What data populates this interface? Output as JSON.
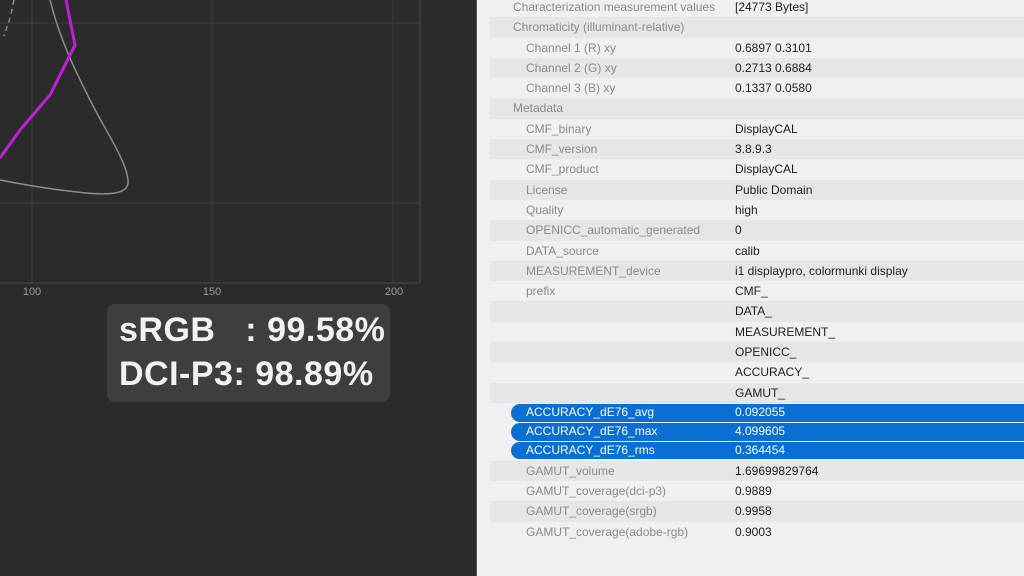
{
  "plot": {
    "x_ticks": [
      "100",
      "150",
      "200"
    ],
    "gamut_color": "#c21ed9",
    "grid_color": "#3d3d3d",
    "locus_color": "#8c8c8c"
  },
  "coverage": {
    "srgb": "sRGB   : 99.58%",
    "dcip3": "DCI-P3: 98.89%"
  },
  "table": {
    "rows": [
      {
        "key": "Characterization measurement values",
        "value": "[24773 Bytes]",
        "level": 0
      },
      {
        "key": "Chromaticity (illuminant-relative)",
        "value": "",
        "level": 0
      },
      {
        "key": "Channel 1 (R) xy",
        "value": "0.6897 0.3101",
        "level": 1
      },
      {
        "key": "Channel 2 (G) xy",
        "value": "0.2713 0.6884",
        "level": 1
      },
      {
        "key": "Channel 3 (B) xy",
        "value": "0.1337 0.0580",
        "level": 1
      },
      {
        "key": "Metadata",
        "value": "",
        "level": 0
      },
      {
        "key": "CMF_binary",
        "value": "DisplayCAL",
        "level": 1
      },
      {
        "key": "CMF_version",
        "value": "3.8.9.3",
        "level": 1
      },
      {
        "key": "CMF_product",
        "value": "DisplayCAL",
        "level": 1
      },
      {
        "key": "License",
        "value": "Public Domain",
        "level": 1
      },
      {
        "key": "Quality",
        "value": "high",
        "level": 1
      },
      {
        "key": "OPENICC_automatic_generated",
        "value": "0",
        "level": 1
      },
      {
        "key": "DATA_source",
        "value": "calib",
        "level": 1
      },
      {
        "key": "MEASUREMENT_device",
        "value": "i1 displaypro, colormunki display",
        "level": 1
      },
      {
        "key": "prefix",
        "value": "CMF_",
        "level": 1
      },
      {
        "key": "",
        "value": "DATA_",
        "level": 1
      },
      {
        "key": "",
        "value": "MEASUREMENT_",
        "level": 1
      },
      {
        "key": "",
        "value": "OPENICC_",
        "level": 1
      },
      {
        "key": "",
        "value": "ACCURACY_",
        "level": 1
      },
      {
        "key": "",
        "value": "GAMUT_",
        "level": 1
      },
      {
        "key": "ACCURACY_dE76_avg",
        "value": "0.092055",
        "level": 1,
        "selected": true
      },
      {
        "key": "ACCURACY_dE76_max",
        "value": "4.099605",
        "level": 1,
        "selected": true
      },
      {
        "key": "ACCURACY_dE76_rms",
        "value": "0.364454",
        "level": 1,
        "selected": true
      },
      {
        "key": "GAMUT_volume",
        "value": "1.69699829764",
        "level": 1
      },
      {
        "key": "GAMUT_coverage(dci-p3)",
        "value": "0.9889",
        "level": 1
      },
      {
        "key": "GAMUT_coverage(srgb)",
        "value": "0.9958",
        "level": 1
      },
      {
        "key": "GAMUT_coverage(adobe-rgb)",
        "value": "0.9003",
        "level": 1
      }
    ]
  }
}
